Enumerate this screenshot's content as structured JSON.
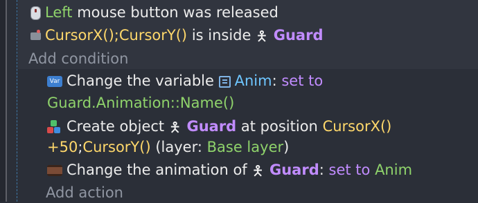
{
  "conditions": [
    {
      "icon": "mouse-icon",
      "parts": [
        "Left",
        "mouse button was released"
      ]
    },
    {
      "icon": "cursor-icon",
      "parts": [
        "CursorX();CursorY()",
        "is inside",
        "Guard"
      ]
    }
  ],
  "add_condition_label": "Add condition",
  "actions": {
    "change_variable": {
      "icon": "variable-icon",
      "icon_text": "Var",
      "text": "Change the variable",
      "var_icon": "scene-variable-icon",
      "var_name": "Anim",
      "colon_set_to": ": ",
      "op": "set to",
      "value": "Guard.Animation::Name()"
    },
    "create_object": {
      "icon": "create-object-icon",
      "text": "Create object",
      "object_icon": "guard-object-icon",
      "object": "Guard",
      "at_position": "at position",
      "x_expr_part1": "CursorX()",
      "x_expr_part2": "+50",
      "sep": ";",
      "y_expr": "CursorY()",
      "layer_open": "(layer:",
      "layer_name": "Base layer",
      "layer_close": ")"
    },
    "change_animation": {
      "icon": "animation-icon",
      "text": "Change the animation of",
      "object_icon": "guard-object-icon",
      "object": "Guard",
      "colon": ":",
      "op": "set to",
      "value": "Anim"
    }
  },
  "add_action_label": "Add action"
}
